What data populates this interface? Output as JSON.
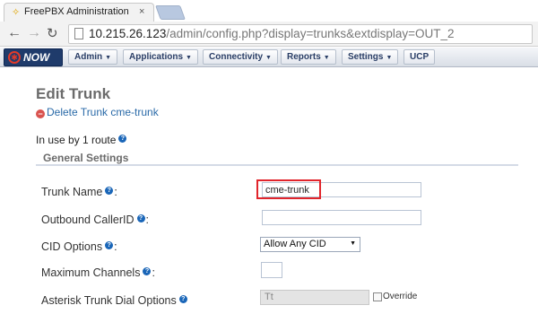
{
  "browser": {
    "tab_title": "FreePBX Administration",
    "tab_favicon": "freepbx-favicon",
    "tab_close": "×",
    "url_host": "10.215.26.123",
    "url_path": "/admin/config.php?display=trunks&extdisplay=OUT_2"
  },
  "menu": {
    "logo_text": "NOW",
    "items": [
      "Admin",
      "Applications",
      "Connectivity",
      "Reports",
      "Settings",
      "UCP"
    ]
  },
  "page": {
    "title": "Edit Trunk",
    "delete_link": "Delete Trunk cme-trunk",
    "in_use": "In use by 1 route",
    "section": "General Settings"
  },
  "fields": {
    "trunk_name_label": "Trunk Name",
    "trunk_name_value": "cme-trunk",
    "outbound_callerid_label": "Outbound CallerID",
    "outbound_callerid_value": "",
    "cid_options_label": "CID Options",
    "cid_options_value": "Allow Any CID",
    "max_channels_label": "Maximum Channels",
    "max_channels_value": "",
    "dial_options_label": "Asterisk Trunk Dial Options",
    "dial_options_value": "Tt",
    "override_label": "Override"
  },
  "colors": {
    "highlight": "#e1252c",
    "link": "#2a6aa8",
    "help_icon": "#1a66b8",
    "menu_text": "#2a3e66"
  }
}
